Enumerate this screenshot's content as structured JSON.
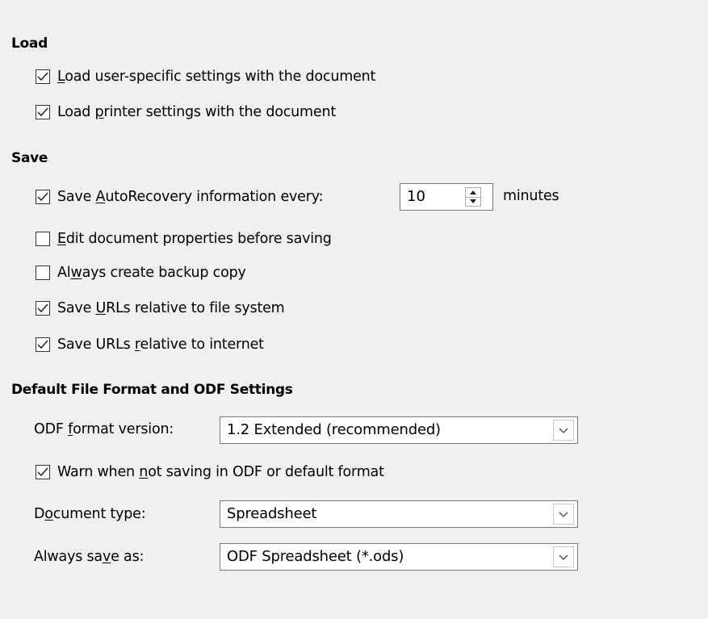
{
  "load": {
    "title": "Load",
    "user_settings": {
      "label": "Load user-specific settings with the document",
      "checked": true
    },
    "printer_settings": {
      "label": "Load printer settings with the document",
      "checked": true
    }
  },
  "save": {
    "title": "Save",
    "autorecovery": {
      "label": "Save AutoRecovery information every:",
      "checked": true,
      "value": "10",
      "unit": "minutes"
    },
    "edit_properties": {
      "label": "Edit document properties before saving",
      "checked": false
    },
    "backup_copy": {
      "label": "Always create backup copy",
      "checked": false
    },
    "urls_file_system": {
      "label": "Save URLs relative to file system",
      "checked": true
    },
    "urls_internet": {
      "label": "Save URLs relative to internet",
      "checked": true
    }
  },
  "default_format": {
    "title": "Default File Format and ODF Settings",
    "odf_version": {
      "label": "ODF format version:",
      "value": "1.2 Extended (recommended)"
    },
    "warn_not_odf": {
      "label": "Warn when not saving in ODF or default format",
      "checked": true
    },
    "document_type": {
      "label": "Document type:",
      "value": "Spreadsheet"
    },
    "always_save_as": {
      "label": "Always save as:",
      "value": "ODF Spreadsheet (*.ods)"
    }
  },
  "icons": {
    "check": "check-mark-icon",
    "dropdown": "chevron-down-icon",
    "spin_up": "triangle-up-icon",
    "spin_down": "triangle-down-icon"
  }
}
